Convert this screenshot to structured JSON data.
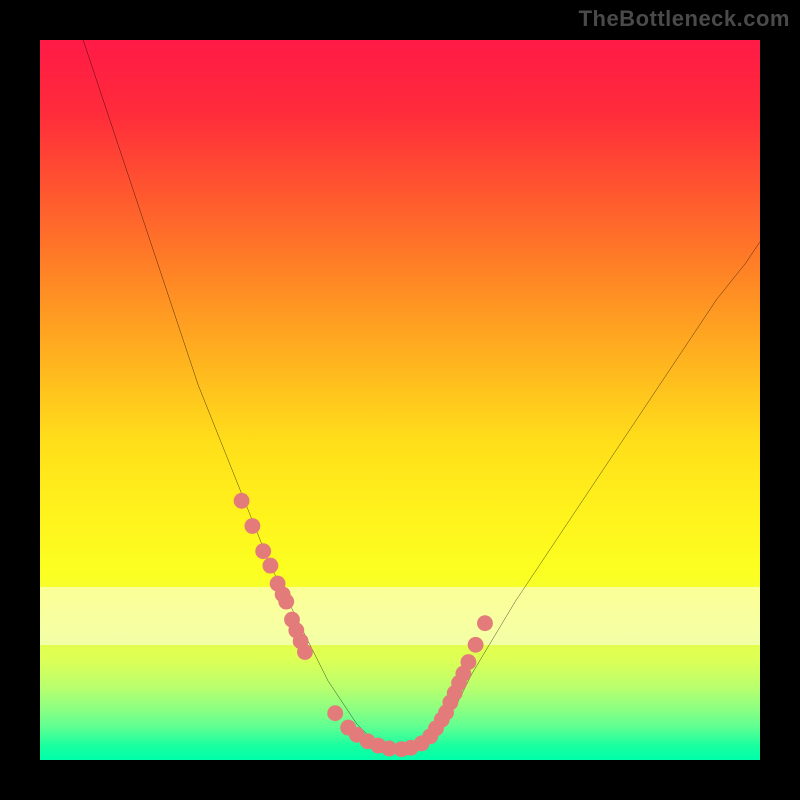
{
  "watermark": "TheBottleneck.com",
  "chart_data": {
    "type": "line",
    "title": "",
    "xlabel": "",
    "ylabel": "",
    "xlim": [
      0,
      100
    ],
    "ylim": [
      0,
      100
    ],
    "grid": false,
    "series": [
      {
        "name": "bottleneck-curve",
        "color": "#000000",
        "x": [
          6,
          8,
          10,
          12,
          14,
          16,
          18,
          20,
          22,
          24,
          26,
          28,
          30,
          32,
          34,
          36,
          38,
          40,
          42,
          44,
          46,
          48,
          50,
          52,
          54,
          56,
          58,
          60,
          63,
          66,
          70,
          74,
          78,
          82,
          86,
          90,
          94,
          98,
          100
        ],
        "y": [
          100,
          94,
          88,
          82,
          76,
          70,
          64,
          58,
          52,
          47,
          42,
          37,
          32,
          27,
          23,
          19,
          15,
          11,
          8,
          5,
          3,
          2,
          1.5,
          2,
          3,
          5,
          8,
          12,
          17,
          22,
          28,
          34,
          40,
          46,
          52,
          58,
          64,
          69,
          72
        ]
      },
      {
        "name": "marker-dots",
        "color": "#e47b7b",
        "type": "scatter",
        "x": [
          28,
          29.5,
          31,
          32,
          33,
          33.7,
          34.2,
          35,
          35.6,
          36.2,
          36.8,
          41,
          42.8,
          44,
          45.5,
          47,
          48.5,
          50.2,
          51.5,
          53,
          54.2,
          55,
          55.8,
          56.4,
          57,
          57.6,
          58.2,
          58.8,
          59.5,
          60.5,
          61.8
        ],
        "y": [
          36,
          32.5,
          29,
          27,
          24.5,
          23,
          22,
          19.5,
          18,
          16.5,
          15,
          6.5,
          4.5,
          3.5,
          2.6,
          2.0,
          1.6,
          1.5,
          1.7,
          2.3,
          3.3,
          4.4,
          5.6,
          6.6,
          8,
          9.3,
          10.7,
          12,
          13.6,
          16,
          19
        ]
      }
    ],
    "background_gradient": {
      "top": "#ff1a46",
      "bottom": "#00ffaa"
    }
  }
}
